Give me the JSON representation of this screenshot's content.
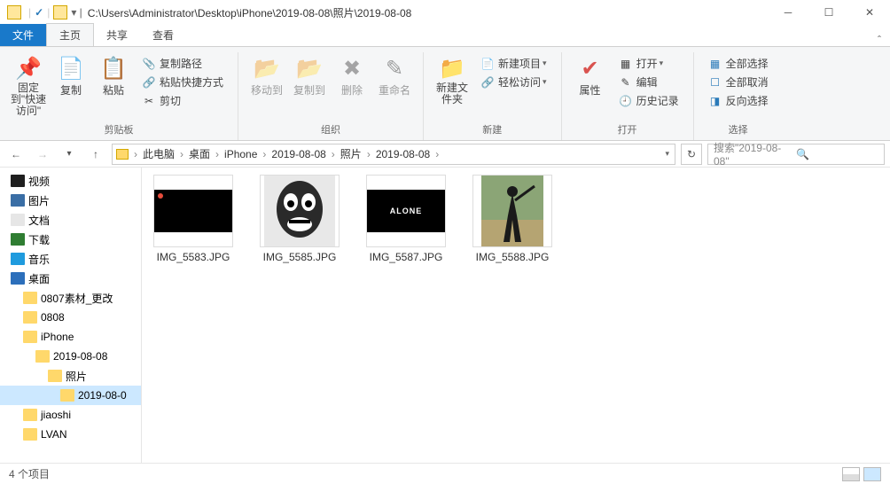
{
  "title_path": "C:\\Users\\Administrator\\Desktop\\iPhone\\2019-08-08\\照片\\2019-08-08",
  "tabs": {
    "file": "文件",
    "home": "主页",
    "share": "共享",
    "view": "查看"
  },
  "ribbon": {
    "pin": "固定到\"快速访问\"",
    "copy": "复制",
    "paste": "粘贴",
    "copypath": "复制路径",
    "pasteshortcut": "粘贴快捷方式",
    "cut": "剪切",
    "moveto": "移动到",
    "copyto": "复制到",
    "delete": "删除",
    "rename": "重命名",
    "newfolder": "新建文件夹",
    "newitem": "新建项目",
    "easyaccess": "轻松访问",
    "properties": "属性",
    "open": "打开",
    "edit": "编辑",
    "history": "历史记录",
    "selectall": "全部选择",
    "selectnone": "全部取消",
    "invert": "反向选择",
    "g_clipboard": "剪贴板",
    "g_organize": "组织",
    "g_new": "新建",
    "g_open": "打开",
    "g_select": "选择"
  },
  "breadcrumbs": [
    "此电脑",
    "桌面",
    "iPhone",
    "2019-08-08",
    "照片",
    "2019-08-08"
  ],
  "search_placeholder": "搜索\"2019-08-08\"",
  "nav": [
    {
      "label": "视频",
      "color": "#1f1f1f",
      "indent": 0
    },
    {
      "label": "图片",
      "color": "#3a6ea5",
      "indent": 0
    },
    {
      "label": "文档",
      "color": "#e6e6e6",
      "indent": 0
    },
    {
      "label": "下载",
      "color": "#2f7d32",
      "indent": 0
    },
    {
      "label": "音乐",
      "color": "#1f9bde",
      "indent": 0
    },
    {
      "label": "桌面",
      "color": "#2c6fbb",
      "indent": 0
    },
    {
      "label": "0807素材_更改",
      "color": "#ffd86b",
      "indent": 1
    },
    {
      "label": "0808",
      "color": "#ffd86b",
      "indent": 1
    },
    {
      "label": "iPhone",
      "color": "#ffd86b",
      "indent": 1
    },
    {
      "label": "2019-08-08",
      "color": "#ffd86b",
      "indent": 2
    },
    {
      "label": "照片",
      "color": "#ffd86b",
      "indent": 3
    },
    {
      "label": "2019-08-0",
      "color": "#ffd86b",
      "indent": 4,
      "sel": true
    },
    {
      "label": "jiaoshi",
      "color": "#ffd86b",
      "indent": 1
    },
    {
      "label": "LVAN",
      "color": "#ffd86b",
      "indent": 1
    }
  ],
  "files": [
    {
      "name": "IMG_5583.JPG",
      "thumb": "black"
    },
    {
      "name": "IMG_5585.JPG",
      "thumb": "face"
    },
    {
      "name": "IMG_5587.JPG",
      "thumb": "alone",
      "text": "ALONE"
    },
    {
      "name": "IMG_5588.JPG",
      "thumb": "shadow"
    }
  ],
  "status": "4 个项目"
}
